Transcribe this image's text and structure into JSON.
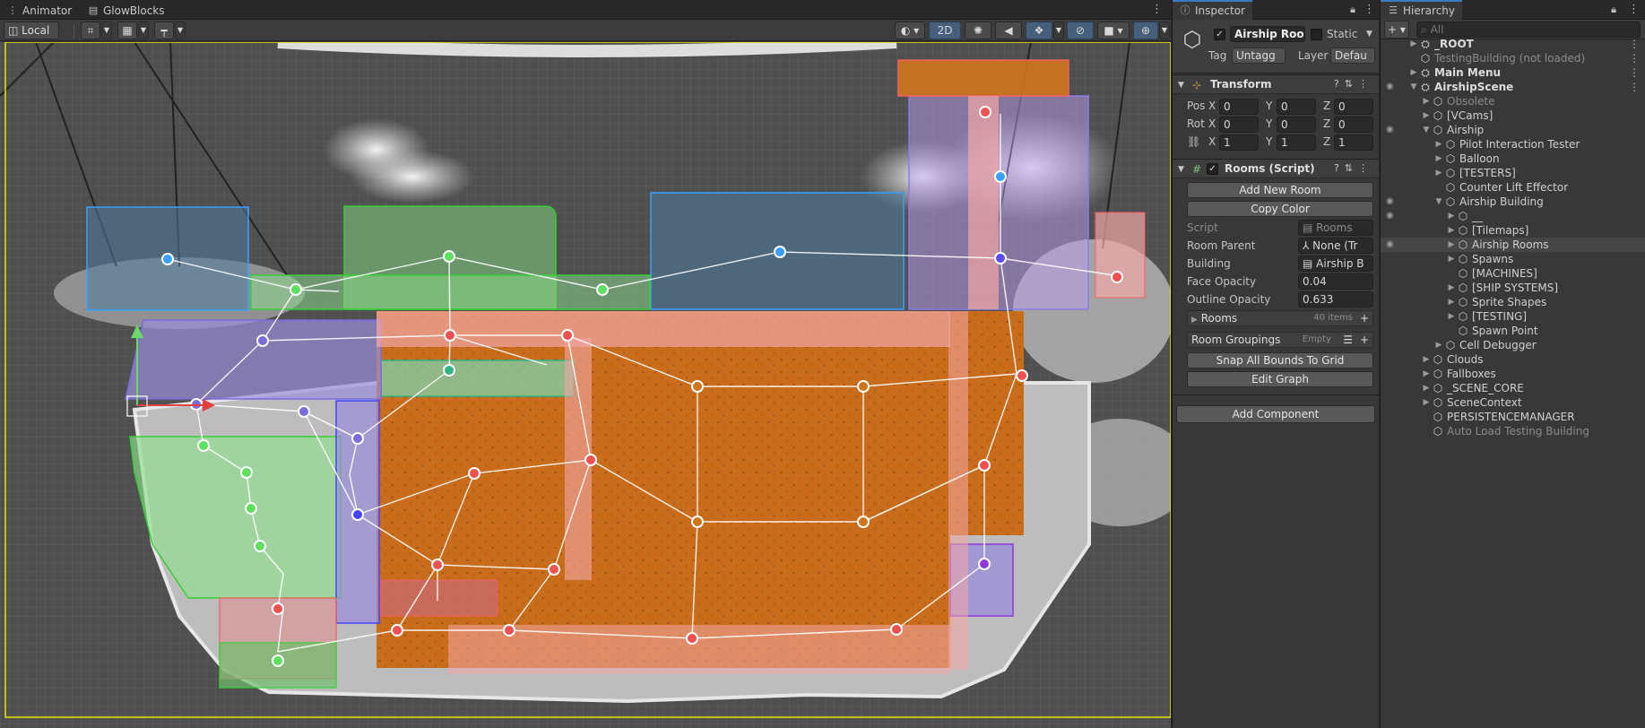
{
  "tabs": {
    "animator": "Animator",
    "glowblocks": "GlowBlocks",
    "inspector": "Inspector",
    "hierarchy": "Hierarchy"
  },
  "scene_toolbar": {
    "pivot_mode": "Local",
    "view_2d": "2D"
  },
  "inspector": {
    "object_name": "Airship Room",
    "static_label": "Static",
    "tag_label": "Tag",
    "tag_value": "Untagg",
    "layer_label": "Layer",
    "layer_value": "Defau",
    "transform": {
      "title": "Transform",
      "position_label": "Pos",
      "rotation_label": "Rot",
      "pos": [
        "0",
        "0",
        "0"
      ],
      "rot": [
        "0",
        "0",
        "0"
      ],
      "scale": [
        "1",
        "1",
        "1"
      ],
      "axes": [
        "X",
        "Y",
        "Z"
      ]
    },
    "rooms_script": {
      "title": "Rooms (Script)",
      "add_new_room": "Add New Room",
      "copy_color": "Copy Color",
      "script_label": "Script",
      "script_value": "Rooms",
      "room_parent_label": "Room Parent",
      "room_parent_value": "None (Tr",
      "building_label": "Building",
      "building_value": "Airship B",
      "face_opacity_label": "Face Opacity",
      "face_opacity_value": "0.04",
      "outline_opacity_label": "Outline Opacity",
      "outline_opacity_value": "0.633",
      "rooms_label": "Rooms",
      "rooms_count": "40 items",
      "room_groupings_label": "Room Groupings",
      "room_groupings_value": "Empty",
      "snap_bounds": "Snap All Bounds To Grid",
      "edit_graph": "Edit Graph"
    },
    "add_component": "Add Component"
  },
  "hierarchy": {
    "search_placeholder": "All",
    "items": [
      {
        "name": "_ROOT",
        "depth": 0,
        "arrow": "right",
        "type": "scene"
      },
      {
        "name": "TestingBuilding (not loaded)",
        "depth": 0,
        "arrow": "none",
        "type": "grey"
      },
      {
        "name": "Main Menu",
        "depth": 0,
        "arrow": "right",
        "type": "scene"
      },
      {
        "name": "AirshipScene",
        "depth": 0,
        "arrow": "down",
        "type": "scene"
      },
      {
        "name": "Obsolete",
        "depth": 1,
        "arrow": "right",
        "type": "grey"
      },
      {
        "name": "[VCams]",
        "depth": 1,
        "arrow": "right",
        "type": "obj"
      },
      {
        "name": "Airship",
        "depth": 1,
        "arrow": "down",
        "type": "obj"
      },
      {
        "name": "Pilot Interaction Tester",
        "depth": 2,
        "arrow": "right",
        "type": "obj"
      },
      {
        "name": "Balloon",
        "depth": 2,
        "arrow": "right",
        "type": "obj"
      },
      {
        "name": "[TESTERS]",
        "depth": 2,
        "arrow": "right",
        "type": "obj"
      },
      {
        "name": "Counter Lift Effector",
        "depth": 2,
        "arrow": "none",
        "type": "obj"
      },
      {
        "name": "Airship Building",
        "depth": 2,
        "arrow": "down",
        "type": "obj"
      },
      {
        "name": "__",
        "depth": 3,
        "arrow": "right",
        "type": "obj"
      },
      {
        "name": "[Tilemaps]",
        "depth": 3,
        "arrow": "right",
        "type": "obj"
      },
      {
        "name": "Airship Rooms",
        "depth": 3,
        "arrow": "right",
        "type": "obj",
        "selected": true
      },
      {
        "name": "Spawns",
        "depth": 3,
        "arrow": "right",
        "type": "obj"
      },
      {
        "name": "[MACHINES]",
        "depth": 3,
        "arrow": "none",
        "type": "obj"
      },
      {
        "name": "[SHIP SYSTEMS]",
        "depth": 3,
        "arrow": "right",
        "type": "obj"
      },
      {
        "name": "Sprite Shapes",
        "depth": 3,
        "arrow": "right",
        "type": "obj"
      },
      {
        "name": "[TESTING]",
        "depth": 3,
        "arrow": "right",
        "type": "obj"
      },
      {
        "name": "Spawn Point",
        "depth": 3,
        "arrow": "none",
        "type": "obj"
      },
      {
        "name": "Cell Debugger",
        "depth": 2,
        "arrow": "right",
        "type": "obj"
      },
      {
        "name": "Clouds",
        "depth": 1,
        "arrow": "right",
        "type": "obj"
      },
      {
        "name": "Fallboxes",
        "depth": 1,
        "arrow": "right",
        "type": "obj"
      },
      {
        "name": "_SCENE_CORE",
        "depth": 1,
        "arrow": "right",
        "type": "obj"
      },
      {
        "name": "SceneContext",
        "depth": 1,
        "arrow": "right",
        "type": "obj"
      },
      {
        "name": "PERSISTENCEMANAGER",
        "depth": 1,
        "arrow": "none",
        "type": "obj"
      },
      {
        "name": "Auto Load Testing Building",
        "depth": 1,
        "arrow": "none",
        "type": "grey"
      }
    ]
  },
  "colors": {
    "panel_bg": "#383838",
    "room_orange": "#d0741e",
    "room_pink": "#f2a6a6",
    "room_green": "#8fe08f",
    "room_blue": "#8fb8e0",
    "room_purple": "#a89ee0",
    "selection_yellow": "#e8e800"
  }
}
